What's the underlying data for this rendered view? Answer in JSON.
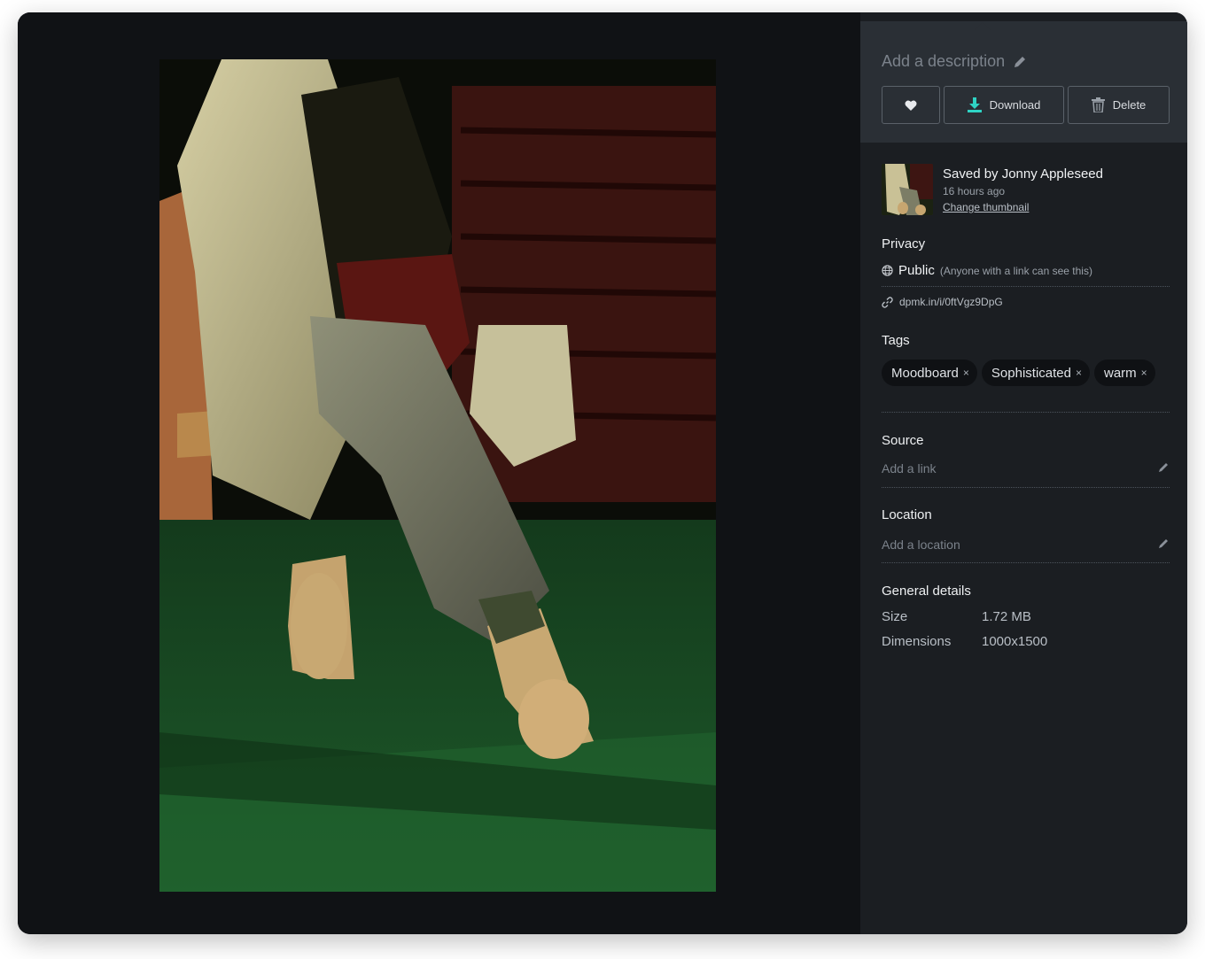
{
  "description": {
    "placeholder": "Add a description"
  },
  "actions": {
    "download_label": "Download",
    "delete_label": "Delete"
  },
  "saved": {
    "by": "Saved by Jonny Appleseed",
    "time": "16 hours ago",
    "change_thumbnail": "Change thumbnail"
  },
  "privacy": {
    "heading": "Privacy",
    "value": "Public",
    "note": "(Anyone with a link can see this)",
    "link": "dpmk.in/i/0ftVgz9DpG"
  },
  "tags": {
    "heading": "Tags",
    "items": [
      "Moodboard",
      "Sophisticated",
      "warm"
    ],
    "remove_glyph": "×"
  },
  "source": {
    "heading": "Source",
    "placeholder": "Add a link"
  },
  "location": {
    "heading": "Location",
    "placeholder": "Add a location"
  },
  "general": {
    "heading": "General details",
    "size_label": "Size",
    "size_value": "1.72 MB",
    "dimensions_label": "Dimensions",
    "dimensions_value": "1000x1500"
  },
  "colors": {
    "accent": "#2fd3c4",
    "panel": "#1b1e22",
    "panel_top": "#2a2f35",
    "stage": "#101215"
  },
  "icons": [
    "pencil-icon",
    "heart-icon",
    "download-icon",
    "trash-icon",
    "globe-icon",
    "link-icon"
  ]
}
